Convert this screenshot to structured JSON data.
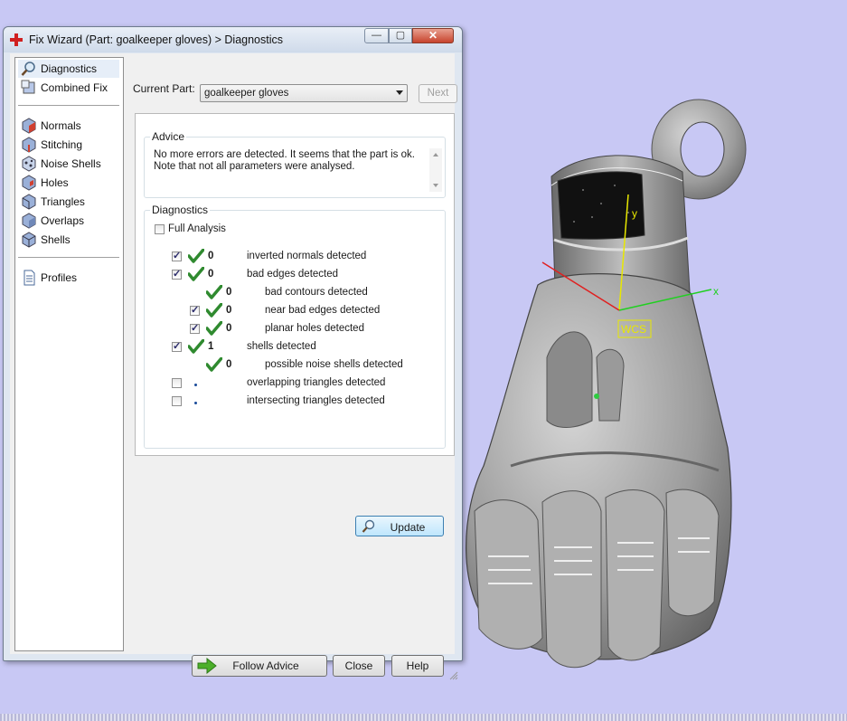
{
  "window": {
    "title": "Fix Wizard (Part: goalkeeper gloves) > Diagnostics",
    "min_glyph": "—",
    "max_glyph": "▢",
    "close_glyph": "✕"
  },
  "nav": {
    "group1": [
      {
        "label": "Diagnostics",
        "icon": "magnifier-icon",
        "selected": true
      },
      {
        "label": "Combined Fix",
        "icon": "combined-fix-icon"
      }
    ],
    "group2": [
      {
        "label": "Normals",
        "icon": "normals-cube-icon"
      },
      {
        "label": "Stitching",
        "icon": "stitching-cube-icon"
      },
      {
        "label": "Noise Shells",
        "icon": "noise-shells-icon"
      },
      {
        "label": "Holes",
        "icon": "holes-cube-icon"
      },
      {
        "label": "Triangles",
        "icon": "triangles-cube-icon"
      },
      {
        "label": "Overlaps",
        "icon": "overlaps-cube-icon"
      },
      {
        "label": "Shells",
        "icon": "shells-cube-icon"
      }
    ],
    "group3": [
      {
        "label": "Profiles",
        "icon": "document-icon"
      }
    ]
  },
  "current_part": {
    "label": "Current Part:",
    "value": "goalkeeper gloves",
    "next_label": "Next"
  },
  "advice": {
    "title": "Advice",
    "line1": "No more errors are detected. It seems that the part is ok.",
    "line2": "Note that not all parameters were analysed."
  },
  "diagnostics": {
    "title": "Diagnostics",
    "full_analysis_label": "Full Analysis",
    "full_analysis_checked": false,
    "rows": [
      {
        "label": "inverted normals detected",
        "count": "0",
        "checked": true,
        "status": "ok",
        "indent": 0
      },
      {
        "label": "bad edges detected",
        "count": "0",
        "checked": true,
        "status": "ok",
        "indent": 0
      },
      {
        "label": "bad contours detected",
        "count": "0",
        "checkbox": false,
        "status": "ok",
        "indent": 1
      },
      {
        "label": "near bad edges detected",
        "count": "0",
        "checked": true,
        "status": "ok",
        "indent": 1
      },
      {
        "label": "planar holes detected",
        "count": "0",
        "checked": true,
        "status": "ok",
        "indent": 1
      },
      {
        "label": "shells detected",
        "count": "1",
        "checked": true,
        "status": "ok",
        "indent": 0
      },
      {
        "label": "possible noise shells detected",
        "count": "0",
        "checkbox": false,
        "status": "ok",
        "indent": 1
      },
      {
        "label": "overlapping triangles detected",
        "count": "",
        "checked": false,
        "status": "pending",
        "indent": 0
      },
      {
        "label": "intersecting triangles detected",
        "count": "",
        "checked": false,
        "status": "pending",
        "indent": 0
      }
    ],
    "update_label": "Update"
  },
  "footer": {
    "follow_label": "Follow Advice",
    "close_label": "Close",
    "help_label": "Help"
  },
  "viewport": {
    "axis_y": "y",
    "axis_x": "x",
    "wcs_label": "WCS",
    "background": "#c8c8f4"
  }
}
